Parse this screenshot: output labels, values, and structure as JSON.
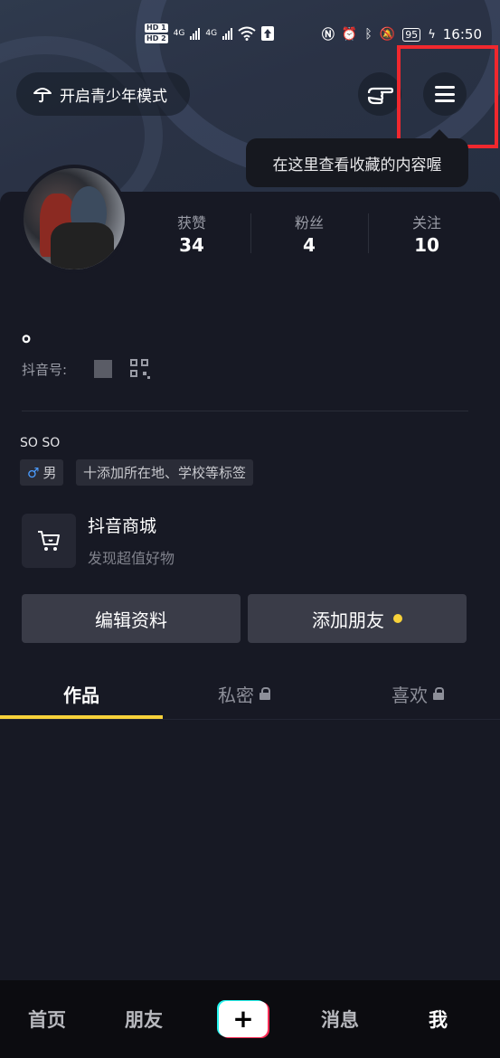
{
  "status_bar": {
    "hd1": "HD 1",
    "hd2": "HD 2",
    "net1": "4G",
    "net2": "4G",
    "battery": "95",
    "time": "16:50"
  },
  "header": {
    "teen_mode_label": "开启青少年模式",
    "tooltip": "在这里查看收藏的内容喔"
  },
  "stats": [
    {
      "label": "获赞",
      "value": "34"
    },
    {
      "label": "粉丝",
      "value": "4"
    },
    {
      "label": "关注",
      "value": "10"
    }
  ],
  "profile": {
    "nickname": "。",
    "douyin_id_label": "抖音号:",
    "bio": "SO SO",
    "gender_symbol": "♂",
    "gender": "男",
    "add_tag_label": "十添加所在地、学校等标签"
  },
  "shop": {
    "title": "抖音商城",
    "subtitle": "发现超值好物"
  },
  "actions": {
    "edit_profile": "编辑资料",
    "add_friend": "添加朋友"
  },
  "tabs": {
    "works": "作品",
    "private": "私密",
    "likes": "喜欢"
  },
  "bottom_nav": {
    "home": "首页",
    "friends": "朋友",
    "plus": "+",
    "messages": "消息",
    "me": "我"
  },
  "colors": {
    "accent_yellow": "#f8d23a",
    "highlight_red": "#f0282e",
    "background": "#171924"
  }
}
